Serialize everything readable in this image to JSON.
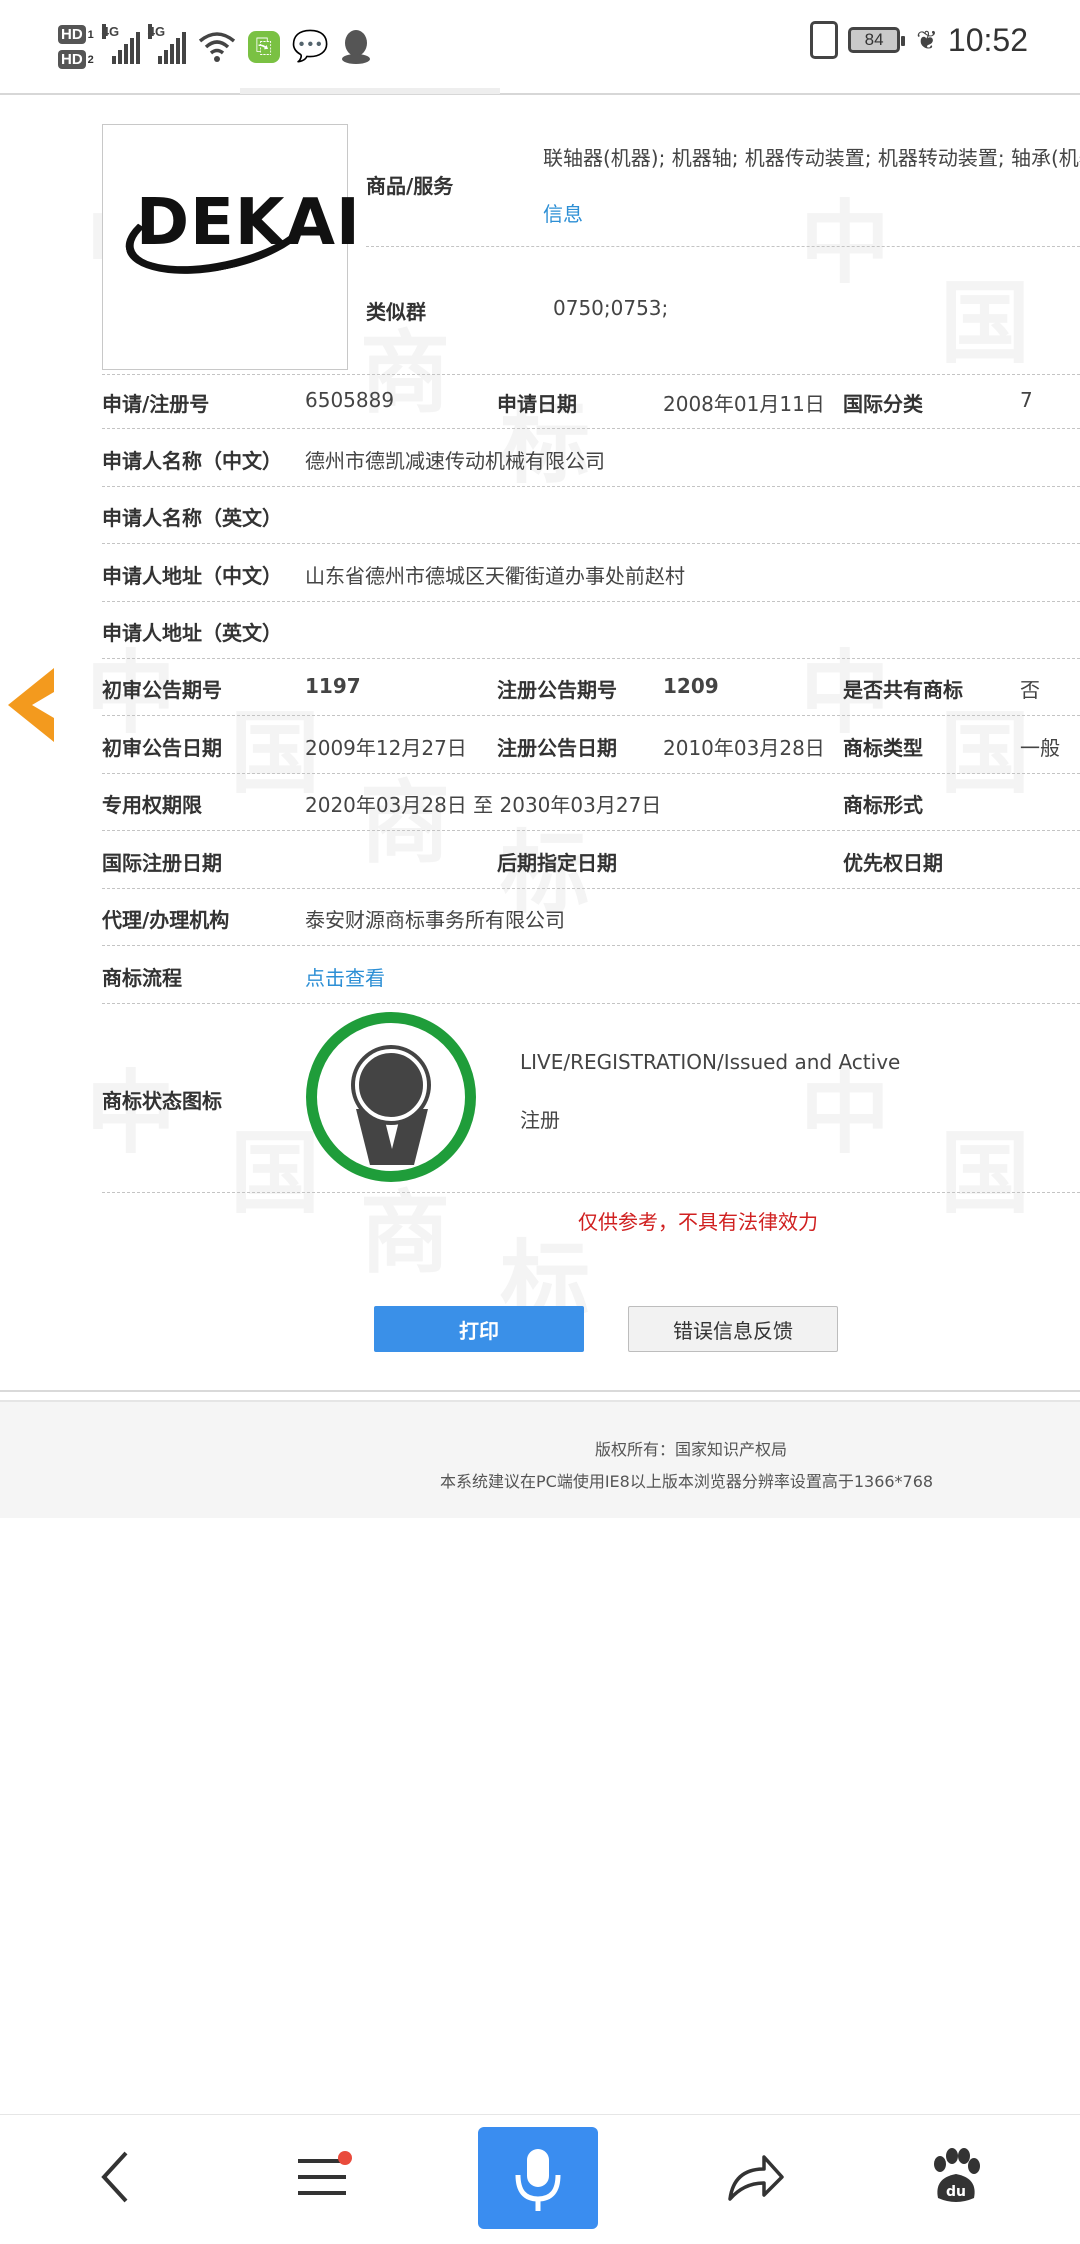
{
  "status_bar": {
    "hd1": "HD",
    "hd1_sub": "1",
    "hd2": "HD",
    "hd2_sub": "2",
    "net1": "4G",
    "net2": "4G",
    "battery": "84",
    "time": "10:52",
    "icons": [
      "signal-icon",
      "wifi-icon",
      "green-app-icon",
      "wechat-icon",
      "qq-icon",
      "vibrate-icon",
      "battery-icon",
      "leaf-icon"
    ]
  },
  "logo": {
    "text": "DEKAI"
  },
  "goods": {
    "label": "商品/服务",
    "value": "联轴器(机器); 机器轴; 机器传动装置; 机器转动装置; 轴承(机器",
    "link": "信息"
  },
  "similar": {
    "label": "类似群",
    "value": "0750;0753;"
  },
  "rows": {
    "reg_no_label": "申请/注册号",
    "reg_no": "6505889",
    "apply_date_label": "申请日期",
    "apply_date": "2008年01月11日",
    "intl_class_label": "国际分类",
    "intl_class": "7",
    "applicant_cn_label": "申请人名称（中文）",
    "applicant_cn": "德州市德凯减速传动机械有限公司",
    "applicant_en_label": "申请人名称（英文）",
    "address_cn_label": "申请人地址（中文）",
    "address_cn": "山东省德州市德城区天衢街道办事处前赵村",
    "address_en_label": "申请人地址（英文）",
    "prelim_no_label": "初审公告期号",
    "prelim_no": "1197",
    "reg_ann_no_label": "注册公告期号",
    "reg_ann_no": "1209",
    "shared_label": "是否共有商标",
    "shared": "否",
    "prelim_date_label": "初审公告日期",
    "prelim_date": "2009年12月27日",
    "reg_ann_date_label": "注册公告日期",
    "reg_ann_date": "2010年03月28日",
    "mark_type_label": "商标类型",
    "mark_type": "一般",
    "term_label": "专用权期限",
    "term": "2020年03月28日 至 2030年03月27日",
    "mark_form_label": "商标形式",
    "intl_reg_date_label": "国际注册日期",
    "later_date_label": "后期指定日期",
    "priority_date_label": "优先权日期",
    "agent_label": "代理/办理机构",
    "agent": "泰安财源商标事务所有限公司",
    "process_label": "商标流程",
    "process_link": "点击查看",
    "status_icon_label": "商标状态图标",
    "status_en": "LIVE/REGISTRATION/Issued and Active",
    "status_cn": "注册"
  },
  "notice": "仅供参考，不具有法律效力",
  "buttons": {
    "print": "打印",
    "feedback": "错误信息反馈"
  },
  "footer": {
    "copyright": "版权所有：国家知识产权局",
    "recommend": "本系统建议在PC端使用IE8以上版本浏览器分辨率设置高于1366*768"
  },
  "colors": {
    "accent": "#3a90e8",
    "link": "#2d8fd5",
    "notice": "#d02020",
    "medal": "#1f9d3a",
    "arrow": "#f39a1e"
  }
}
